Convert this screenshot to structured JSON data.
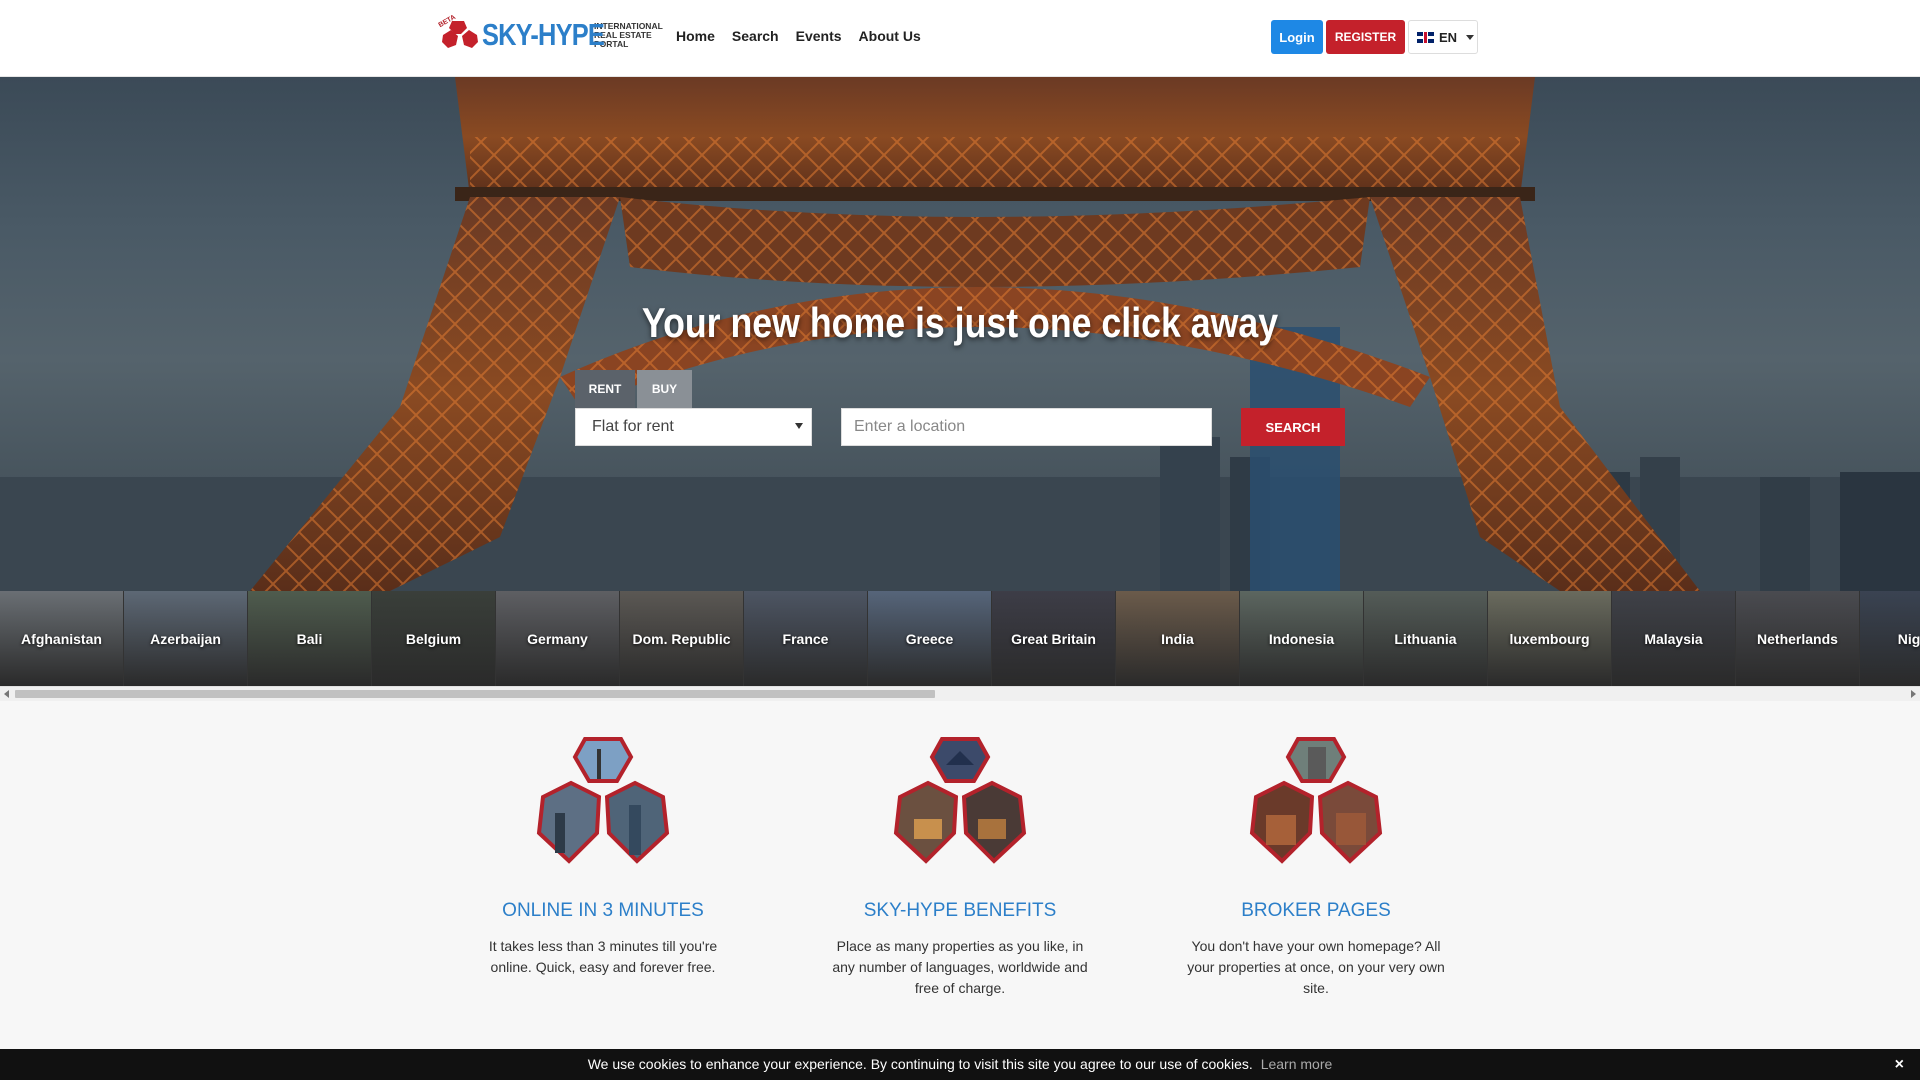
{
  "header": {
    "logo": {
      "brand": "SKY-HYPE",
      "badge": "BETA",
      "tagline": [
        "INTERNATIONAL",
        "REAL ESTATE",
        "PORTAL"
      ]
    },
    "nav": [
      {
        "label": "Home"
      },
      {
        "label": "Search"
      },
      {
        "label": "Events"
      },
      {
        "label": "About Us"
      }
    ],
    "login_label": "Login",
    "register_label": "REGISTER",
    "language": "EN"
  },
  "hero": {
    "title": "Your new home is just one click away",
    "tabs": [
      "RENT",
      "BUY"
    ],
    "property_type": "Flat for rent",
    "location_placeholder": "Enter a location",
    "search_label": "SEARCH"
  },
  "countries": [
    {
      "name": "Afghanistan",
      "color": "#6a6f74"
    },
    {
      "name": "Azerbaijan",
      "color": "#5d6875"
    },
    {
      "name": "Bali",
      "color": "#4f5c4e"
    },
    {
      "name": "Belgium",
      "color": "#3a3f3a"
    },
    {
      "name": "Germany",
      "color": "#5e5f63"
    },
    {
      "name": "Dom. Republic",
      "color": "#5b5854"
    },
    {
      "name": "France",
      "color": "#4d5563"
    },
    {
      "name": "Greece",
      "color": "#56657a"
    },
    {
      "name": "Great Britain",
      "color": "#3d3d47"
    },
    {
      "name": "India",
      "color": "#6b5b4b"
    },
    {
      "name": "Indonesia",
      "color": "#5c6660"
    },
    {
      "name": "Lithuania",
      "color": "#545c58"
    },
    {
      "name": "luxembourg",
      "color": "#6a6b5e"
    },
    {
      "name": "Malaysia",
      "color": "#3f4148"
    },
    {
      "name": "Netherlands",
      "color": "#4a4b50"
    },
    {
      "name": "Nigeria",
      "color": "#3a4352"
    }
  ],
  "features": [
    {
      "title": "ONLINE IN 3 MINUTES",
      "text": "It takes less than 3 minutes till you're online. Quick, easy and forever free."
    },
    {
      "title": "SKY-HYPE BENEFITS",
      "text": "Place as many properties as you like, in any number of languages, worldwide and free of charge."
    },
    {
      "title": "BROKER PAGES",
      "text": "You don't have your own homepage? All your properties at once, on your very own site."
    }
  ],
  "cookie": {
    "text": "We use cookies to enhance your experience. By continuing to visit this site you agree to our use of cookies.",
    "link": "Learn more",
    "close": "×"
  },
  "colors": {
    "brand_blue": "#2c7fc9",
    "brand_red": "#c4212b",
    "login_blue": "#1e88e5"
  }
}
